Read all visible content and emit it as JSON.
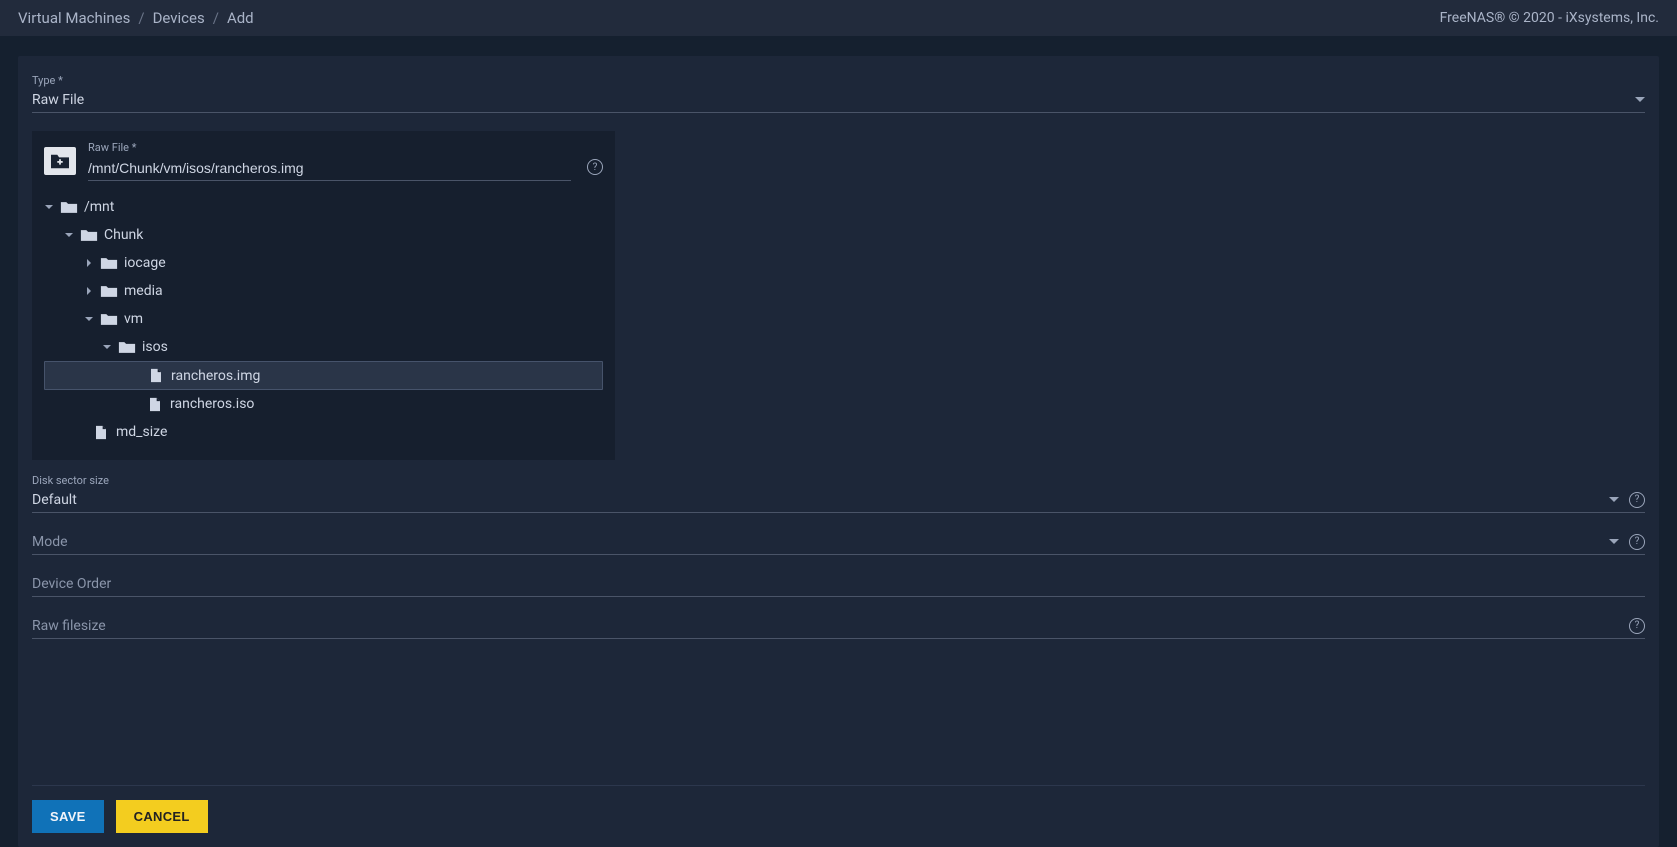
{
  "breadcrumbs": [
    "Virtual Machines",
    "Devices",
    "Add"
  ],
  "brand": "FreeNAS® © 2020 - iXsystems, Inc.",
  "form": {
    "type": {
      "label": "Type *",
      "value": "Raw File"
    },
    "rawfile": {
      "label": "Raw File *",
      "value": "/mnt/Chunk/vm/isos/rancheros.img"
    },
    "sectorsize": {
      "label": "Disk sector size",
      "value": "Default"
    },
    "mode": {
      "label": "Mode",
      "value": ""
    },
    "deviceorder": {
      "label": "Device Order",
      "value": ""
    },
    "rawfilesize": {
      "label": "Raw filesize",
      "value": ""
    }
  },
  "tree": {
    "mnt": "/mnt",
    "chunk": "Chunk",
    "iocage": "iocage",
    "media": "media",
    "vm": "vm",
    "isos": "isos",
    "rancheros_img": "rancheros.img",
    "rancheros_iso": "rancheros.iso",
    "md_size": "md_size"
  },
  "buttons": {
    "save": "SAVE",
    "cancel": "CANCEL"
  }
}
